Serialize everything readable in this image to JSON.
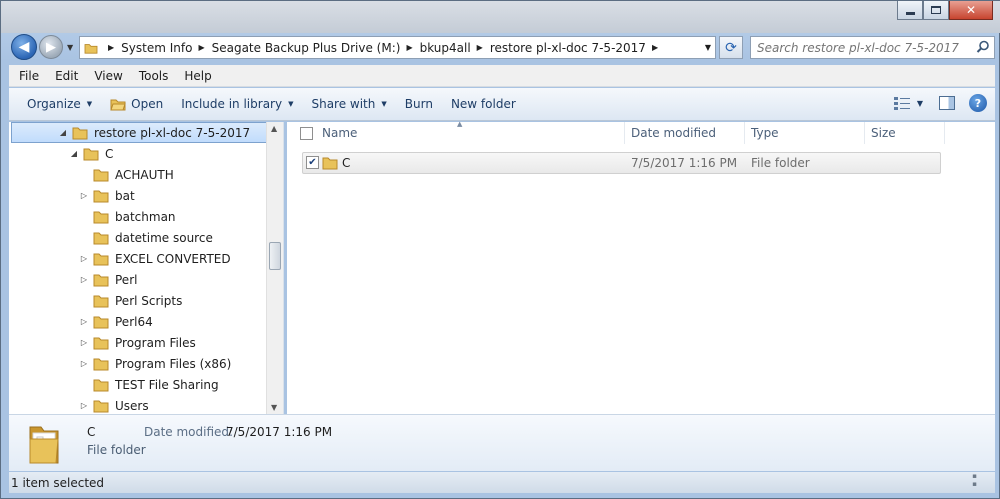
{
  "window": {
    "minimize_label": "–",
    "close_label": "✕"
  },
  "address": {
    "crumbs": [
      "System Info",
      "Seagate Backup Plus Drive (M:)",
      "bkup4all",
      "restore pl-xl-doc 7-5-2017"
    ],
    "search_placeholder": "Search restore pl-xl-doc 7-5-2017"
  },
  "menu": {
    "items": [
      "File",
      "Edit",
      "View",
      "Tools",
      "Help"
    ]
  },
  "toolbar": {
    "organize": "Organize",
    "open": "Open",
    "include_in_library": "Include in library",
    "share_with": "Share with",
    "burn": "Burn",
    "new_folder": "New folder"
  },
  "nav_tree": {
    "items": [
      {
        "label": "restore pl-xl-doc 7-5-2017",
        "expander": "◢",
        "selected": true
      },
      {
        "label": "C",
        "expander": "◢"
      },
      {
        "label": "ACHAUTH",
        "expander": ""
      },
      {
        "label": "bat",
        "expander": "▷"
      },
      {
        "label": "batchman",
        "expander": ""
      },
      {
        "label": "datetime source",
        "expander": ""
      },
      {
        "label": "EXCEL CONVERTED",
        "expander": "▷"
      },
      {
        "label": "Perl",
        "expander": "▷"
      },
      {
        "label": "Perl Scripts",
        "expander": ""
      },
      {
        "label": "Perl64",
        "expander": "▷"
      },
      {
        "label": "Program Files",
        "expander": "▷"
      },
      {
        "label": "Program Files (x86)",
        "expander": "▷"
      },
      {
        "label": "TEST File Sharing",
        "expander": ""
      },
      {
        "label": "Users",
        "expander": "▷"
      }
    ]
  },
  "columns": {
    "name": "Name",
    "date_modified": "Date modified",
    "type": "Type",
    "size": "Size"
  },
  "files": [
    {
      "name": "C",
      "date_modified": "7/5/2017 1:16 PM",
      "type": "File folder",
      "size": "",
      "checked": true
    }
  ],
  "details": {
    "name": "C",
    "type": "File folder",
    "date_label": "Date modified:",
    "date_value": "7/5/2017 1:16 PM"
  },
  "status": {
    "text": "1 item selected"
  },
  "colors": {
    "folder": "#e8c25a",
    "folder_dark": "#c9962e",
    "accent": "#2c66b5"
  }
}
